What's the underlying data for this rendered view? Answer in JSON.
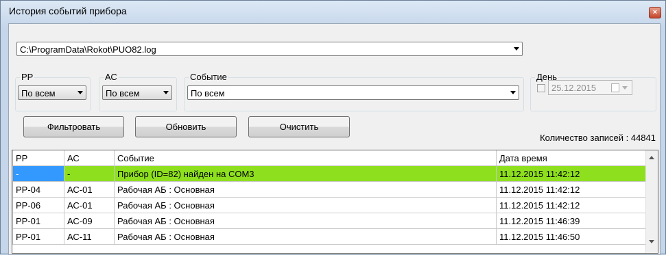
{
  "window": {
    "title": "История событий прибора",
    "close_symbol": "×"
  },
  "file_path": "C:\\ProgramData\\Rokot\\PUO82.log",
  "filters": {
    "rr": {
      "label": "РР",
      "value": "По всем"
    },
    "ac": {
      "label": "АС",
      "value": "По всем"
    },
    "event": {
      "label": "Событие",
      "value": "По всем"
    },
    "day": {
      "label": "День",
      "value": "25.12.2015",
      "checked": false
    }
  },
  "buttons": {
    "filter": "Фильтровать",
    "refresh": "Обновить",
    "clear": "Очистить"
  },
  "count_text": "Количество записей : 44841",
  "table": {
    "columns": [
      "РР",
      "АС",
      "Событие",
      "Дата время"
    ],
    "rows": [
      {
        "rr": "-",
        "ac": "-",
        "event": "Прибор (ID=82) найден на COM3",
        "datetime": "11.12.2015 11:42:12"
      },
      {
        "rr": "РР-04",
        "ac": "АС-01",
        "event": "Рабочая АБ : Основная",
        "datetime": "11.12.2015 11:42:12"
      },
      {
        "rr": "РР-06",
        "ac": "АС-01",
        "event": "Рабочая АБ : Основная",
        "datetime": "11.12.2015 11:42:12"
      },
      {
        "rr": "РР-01",
        "ac": "АС-09",
        "event": "Рабочая АБ : Основная",
        "datetime": "11.12.2015 11:46:39"
      },
      {
        "rr": "РР-01",
        "ac": "АС-11",
        "event": "Рабочая АБ : Основная",
        "datetime": "11.12.2015 11:46:50"
      }
    ]
  },
  "colors": {
    "highlight_row": "#8ee01f",
    "selected_cell": "#3399ff"
  }
}
